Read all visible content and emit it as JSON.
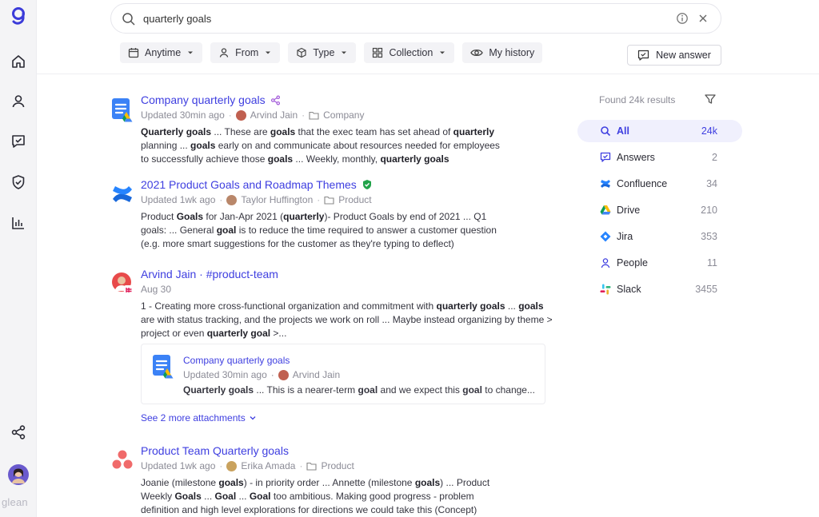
{
  "brand": {
    "name": "glean"
  },
  "search": {
    "query": "quarterly goals"
  },
  "filters": [
    {
      "label": "Anytime"
    },
    {
      "label": "From"
    },
    {
      "label": "Type"
    },
    {
      "label": "Collection"
    },
    {
      "label": "My history"
    }
  ],
  "new_answer_label": "New answer",
  "results": [
    {
      "title": "Company quarterly goals",
      "updated": "Updated 30min ago",
      "author": "Arvind Jain",
      "folder": "Company",
      "snippet_line1_a": "Quarterly goals",
      "snippet_line1_b": " ... These are ",
      "snippet_line1_c": "goals",
      "snippet_line1_d": " that the exec team has set ahead of ",
      "snippet_line1_e": "quarterly",
      "snippet_line2_a": "planning ... ",
      "snippet_line2_b": "goals",
      "snippet_line2_c": " early on and communicate about resources needed for employees",
      "snippet_line3_a": "to successfully achieve those ",
      "snippet_line3_b": "goals",
      "snippet_line3_c": " ... Weekly, monthly, ",
      "snippet_line3_d": "quarterly goals"
    },
    {
      "title": "2021 Product Goals and Roadmap Themes",
      "updated": "Updated 1wk ago",
      "author": "Taylor Huffington",
      "folder": "Product",
      "snippet_line1_a": "Product ",
      "snippet_line1_b": "Goals",
      "snippet_line1_c": " for Jan-Apr 2021 (",
      "snippet_line1_d": "quarterly",
      "snippet_line1_e": ")- Product Goals by end of 2021 ... Q1",
      "snippet_line2_a": "goals: ... General ",
      "snippet_line2_b": "goal",
      "snippet_line2_c": " is to reduce the time required to answer a customer question",
      "snippet_line3": "(e.g. more smart suggestions for the customer as they're typing to deflect)"
    },
    {
      "title": "Arvind Jain · #product-team",
      "updated": "Aug 30",
      "snippet_line1_a": "1 - Creating more cross-functional organization and commitment with ",
      "snippet_line1_b": "quarterly goals",
      "snippet_line1_c": " ... ",
      "snippet_line1_d": "goals",
      "snippet_line2": "are with status tracking, and the projects we work on roll ... Maybe instead organizing by theme >",
      "snippet_line3_a": "project or even ",
      "snippet_line3_b": "quarterly goal",
      "snippet_line3_c": " >...",
      "attachment": {
        "title": "Company quarterly goals",
        "updated": "Updated 30min ago",
        "author": "Arvind Jain",
        "snippet_a": "Quarterly goals",
        "snippet_b": " ... This is a nearer-term ",
        "snippet_c": "goal",
        "snippet_d": " and we expect this ",
        "snippet_e": "goal",
        "snippet_f": " to change..."
      },
      "see_more": "See 2 more attachments"
    },
    {
      "title": "Product Team Quarterly goals",
      "updated": "Updated 1wk ago",
      "author": "Erika Amada",
      "folder": "Product",
      "snippet_line1_a": "Joanie (milestone ",
      "snippet_line1_b": "goals",
      "snippet_line1_c": ") - in priority order ... Annette (milestone ",
      "snippet_line1_d": "goals",
      "snippet_line1_e": ") ... Product",
      "snippet_line2_a": "Weekly ",
      "snippet_line2_b": "Goals",
      "snippet_line2_c": " ... ",
      "snippet_line2_d": "Goal",
      "snippet_line2_e": " ... ",
      "snippet_line2_f": "Goal",
      "snippet_line2_g": " too ambitious. Making good progress - problem",
      "snippet_line3": "definition and high level explorations for directions we could take this (Concept)"
    }
  ],
  "right_panel": {
    "found": "Found 24k results",
    "sources": [
      {
        "label": "All",
        "count": "24k",
        "icon": "search-icon"
      },
      {
        "label": "Answers",
        "count": "2",
        "icon": "answers-icon"
      },
      {
        "label": "Confluence",
        "count": "34",
        "icon": "confluence-icon"
      },
      {
        "label": "Drive",
        "count": "210",
        "icon": "drive-icon"
      },
      {
        "label": "Jira",
        "count": "353",
        "icon": "jira-icon"
      },
      {
        "label": "People",
        "count": "11",
        "icon": "person-icon"
      },
      {
        "label": "Slack",
        "count": "3455",
        "icon": "slack-icon"
      }
    ]
  },
  "colors": {
    "accent": "#3e3ee0",
    "brand": "#3b3bd9",
    "active_bg": "#f0f0fd"
  }
}
